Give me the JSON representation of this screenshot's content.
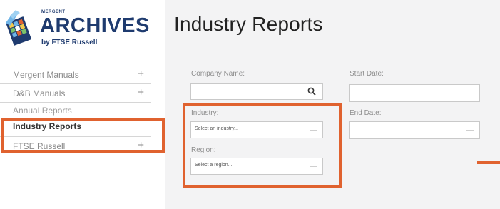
{
  "logo": {
    "small_text": "MERGENT",
    "name": "ARCHIVES",
    "trademark": "™",
    "byline": "by FTSE Russell"
  },
  "sidebar": {
    "items": [
      {
        "label": "Mergent Manuals",
        "expander": "+"
      },
      {
        "label": "D&B Manuals",
        "expander": "+"
      },
      {
        "label": "Annual Reports",
        "expander": ""
      },
      {
        "label": "Industry Reports",
        "expander": ""
      },
      {
        "label": "FTSE Russell",
        "expander": "+"
      }
    ]
  },
  "main": {
    "title": "Industry Reports",
    "form": {
      "company_name": {
        "label": "Company Name:",
        "value": "",
        "icon": "search-icon"
      },
      "industry": {
        "label": "Industry:",
        "placeholder": "Select an industry..."
      },
      "region": {
        "label": "Region:",
        "placeholder": "Select a region..."
      },
      "start_date": {
        "label": "Start Date:",
        "value": ""
      },
      "end_date": {
        "label": "End Date:",
        "value": ""
      }
    }
  },
  "annotation_color": "#e0622f"
}
